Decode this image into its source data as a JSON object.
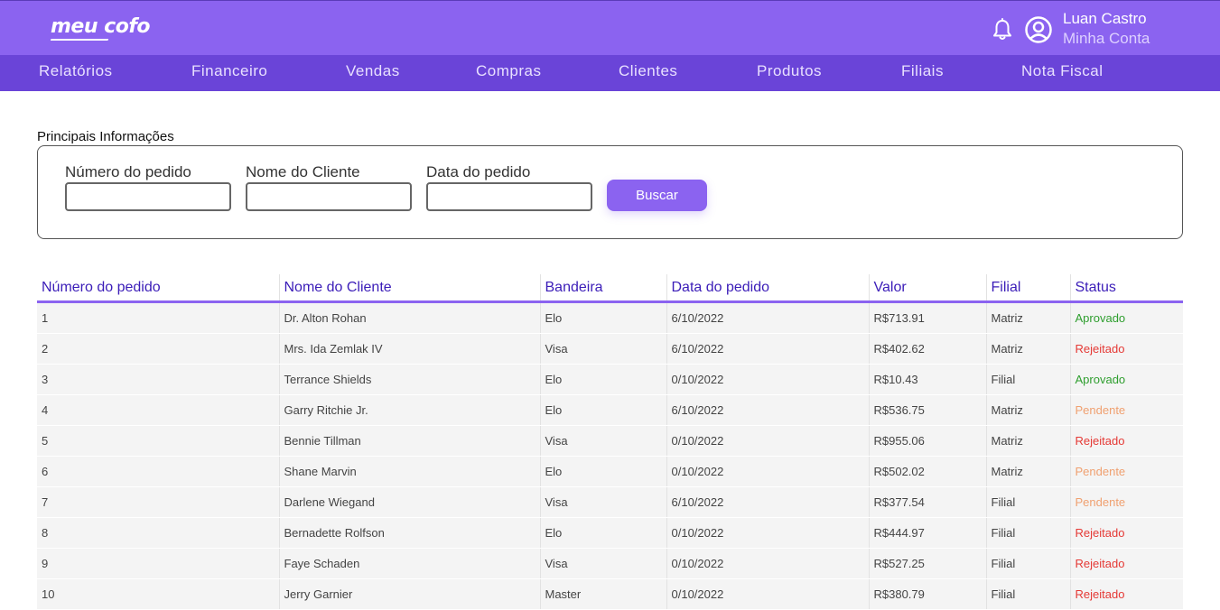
{
  "header": {
    "logo_text": "meu cofo",
    "user_name": "Luan Castro",
    "account_label": "Minha Conta"
  },
  "nav": [
    {
      "label": "Relatórios"
    },
    {
      "label": "Financeiro"
    },
    {
      "label": "Vendas"
    },
    {
      "label": "Compras"
    },
    {
      "label": "Clientes"
    },
    {
      "label": "Produtos"
    },
    {
      "label": "Filiais"
    },
    {
      "label": "Nota Fiscal"
    }
  ],
  "filters": {
    "title": "Principais Informações",
    "order_number_label": "Número do pedido",
    "order_number_value": "",
    "client_name_label": "Nome do Cliente",
    "client_name_value": "",
    "order_date_label": "Data do pedido",
    "order_date_value": "",
    "search_button": "Buscar"
  },
  "table": {
    "columns": [
      "Número do pedido",
      "Nome do Cliente",
      "Bandeira",
      "Data do pedido",
      "Valor",
      "Filial",
      "Status"
    ],
    "rows": [
      {
        "id": "1",
        "client": "Dr. Alton Rohan",
        "brand": "Elo",
        "date": "6/10/2022",
        "value": "R$713.91",
        "branch": "Matriz",
        "status": "Aprovado"
      },
      {
        "id": "2",
        "client": "Mrs. Ida Zemlak IV",
        "brand": "Visa",
        "date": "6/10/2022",
        "value": "R$402.62",
        "branch": "Matriz",
        "status": "Rejeitado"
      },
      {
        "id": "3",
        "client": "Terrance Shields",
        "brand": "Elo",
        "date": "0/10/2022",
        "value": "R$10.43",
        "branch": "Filial",
        "status": "Aprovado"
      },
      {
        "id": "4",
        "client": "Garry Ritchie Jr.",
        "brand": "Elo",
        "date": "6/10/2022",
        "value": "R$536.75",
        "branch": "Matriz",
        "status": "Pendente"
      },
      {
        "id": "5",
        "client": "Bennie Tillman",
        "brand": "Visa",
        "date": "0/10/2022",
        "value": "R$955.06",
        "branch": "Matriz",
        "status": "Rejeitado"
      },
      {
        "id": "6",
        "client": "Shane Marvin",
        "brand": "Elo",
        "date": "0/10/2022",
        "value": "R$502.02",
        "branch": "Matriz",
        "status": "Pendente"
      },
      {
        "id": "7",
        "client": "Darlene Wiegand",
        "brand": "Visa",
        "date": "6/10/2022",
        "value": "R$377.54",
        "branch": "Filial",
        "status": "Pendente"
      },
      {
        "id": "8",
        "client": "Bernadette Rolfson",
        "brand": "Elo",
        "date": "0/10/2022",
        "value": "R$444.97",
        "branch": "Filial",
        "status": "Rejeitado"
      },
      {
        "id": "9",
        "client": "Faye Schaden",
        "brand": "Visa",
        "date": "0/10/2022",
        "value": "R$527.25",
        "branch": "Filial",
        "status": "Rejeitado"
      },
      {
        "id": "10",
        "client": "Jerry Garnier",
        "brand": "Master",
        "date": "0/10/2022",
        "value": "R$380.79",
        "branch": "Filial",
        "status": "Rejeitado"
      }
    ]
  },
  "colors": {
    "brand_primary": "#8b63f0",
    "nav_background": "#6a44d8",
    "header_text": "#3b1db8",
    "status_aprovado": "#2e9e2e",
    "status_rejeitado": "#e53935",
    "status_pendente": "#f0a070"
  },
  "icons": [
    "bell-icon",
    "user-circle-icon"
  ]
}
